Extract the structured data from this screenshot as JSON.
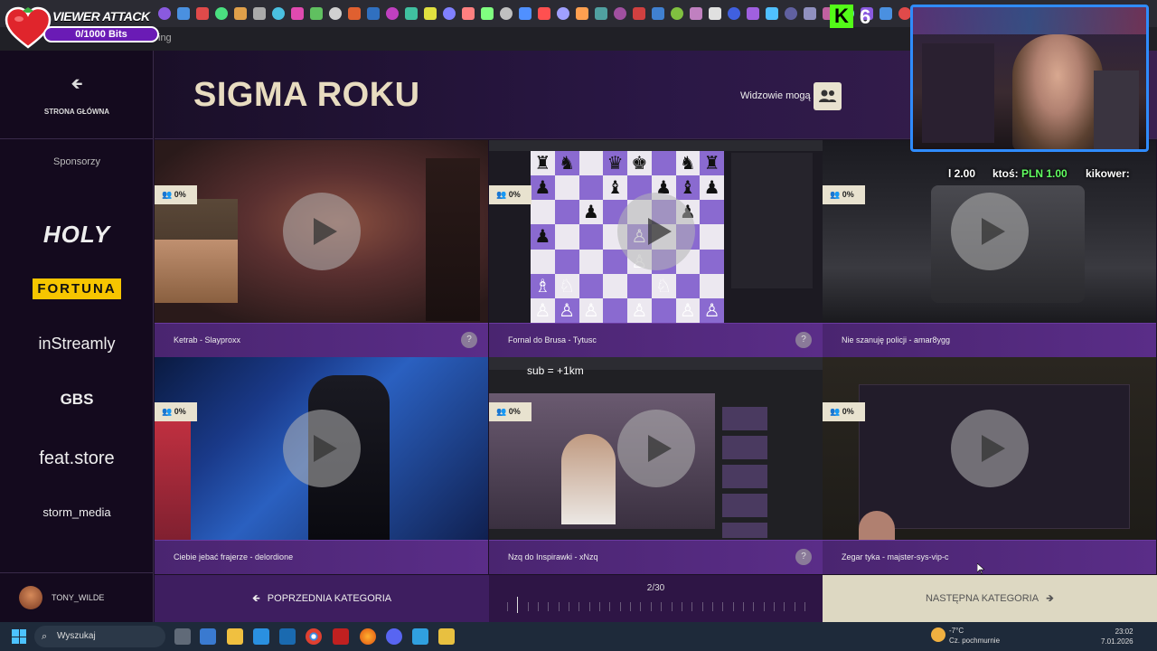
{
  "overlay": {
    "viewer_attack_title": "VIEWER ATTACK",
    "viewer_attack_bits": "0/1000 Bits",
    "kick_icon_letter": "K",
    "kick_count": "6",
    "address_fragment": "ing"
  },
  "sidebar": {
    "home_label": "STRONA GŁÓWNA",
    "sponsors_title": "Sponsorzy",
    "sponsors": [
      "HOLY",
      "FORTUNA",
      "inStreamly",
      "GBS",
      "feat.store",
      "storm_media"
    ],
    "user_name": "TONY_WILDE"
  },
  "header": {
    "title": "SIGMA ROKU",
    "viewers_label": "Widzowie mogą"
  },
  "tiles": [
    {
      "title": "Ketrab - Slayproxx",
      "pct": "0%",
      "has_help": true
    },
    {
      "title": "Fornal do Brusa - Tytusc",
      "pct": "0%",
      "has_help": true
    },
    {
      "title": "Nie szanuję policji - amar8ygg",
      "pct": "0%",
      "has_help": false
    },
    {
      "title": "Ciebie jebać frajerze - delordione",
      "pct": "0%",
      "has_help": false
    },
    {
      "title": "Nzq do Inspirawki - xNzq",
      "pct": "0%",
      "has_help": true
    },
    {
      "title": "Zegar tyka - majster-sys-vip-c",
      "pct": "0%",
      "has_help": false
    }
  ],
  "help_symbol": "?",
  "nav": {
    "prev_label": "POPRZEDNIA KATEGORIA",
    "next_label": "NASTĘPNA KATEGORIA",
    "page": "2/30",
    "page_current": 2,
    "page_total": 30
  },
  "stream_overlay": {
    "donation_1_prefix": "",
    "donation_1_value": "l 2.00",
    "donation_2_prefix": "ktoś: ",
    "donation_2_value": "PLN 1.00",
    "donation_3": "kikower:"
  },
  "video_overlay_text": {
    "sub_text": "sub = +1km"
  },
  "taskbar": {
    "search_placeholder": "Wyszukaj",
    "weather_temp": "-7°C",
    "weather_desc": "Cz. pochmurnie",
    "time": "23:02",
    "date": "7.01.2026"
  },
  "colors": {
    "accent_cream": "#e8e2cf",
    "title_color": "#e8dcc0",
    "tile_bar": "#5a2d88",
    "webcam_border": "#2f8cff"
  }
}
